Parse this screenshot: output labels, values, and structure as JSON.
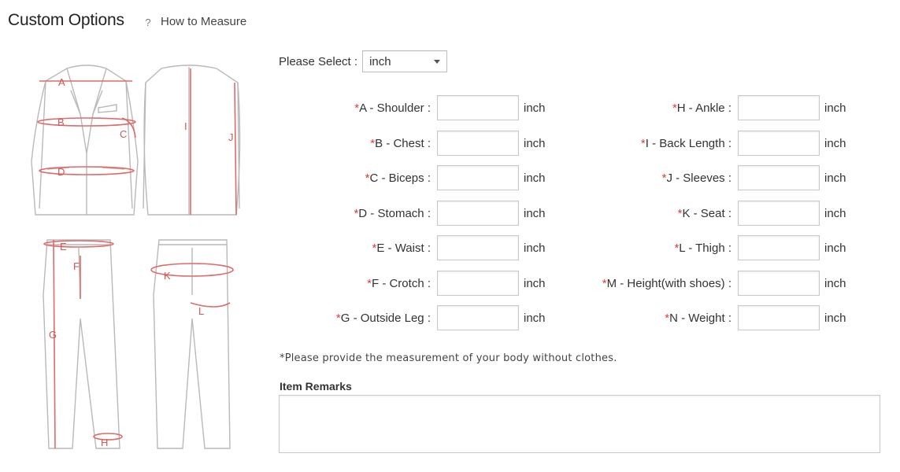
{
  "header": {
    "title": "Custom Options",
    "how_to_icon": "question-icon",
    "how_to_label": "How to Measure",
    "how_to_glyph": "?",
    "close_glyph": "^"
  },
  "unit_select": {
    "label": "Please Select :",
    "value": "inch"
  },
  "diagram_letters": [
    "A",
    "B",
    "C",
    "D",
    "E",
    "F",
    "G",
    "H",
    "I",
    "J",
    "K",
    "L"
  ],
  "fields_left": [
    {
      "label": "A - Shoulder :",
      "unit": "inch",
      "value": ""
    },
    {
      "label": "B - Chest :",
      "unit": "inch",
      "value": ""
    },
    {
      "label": "C - Biceps :",
      "unit": "inch",
      "value": ""
    },
    {
      "label": "D - Stomach :",
      "unit": "inch",
      "value": ""
    },
    {
      "label": "E - Waist :",
      "unit": "inch",
      "value": ""
    },
    {
      "label": "F - Crotch :",
      "unit": "inch",
      "value": ""
    },
    {
      "label": "G - Outside Leg :",
      "unit": "inch",
      "value": ""
    }
  ],
  "fields_right": [
    {
      "label": "H - Ankle :",
      "unit": "inch",
      "value": ""
    },
    {
      "label": "I - Back Length :",
      "unit": "inch",
      "value": ""
    },
    {
      "label": "J - Sleeves :",
      "unit": "inch",
      "value": ""
    },
    {
      "label": "K - Seat :",
      "unit": "inch",
      "value": ""
    },
    {
      "label": "L - Thigh :",
      "unit": "inch",
      "value": ""
    },
    {
      "label": "M - Height(with shoes) :",
      "unit": "inch",
      "value": ""
    },
    {
      "label": "N - Weight :",
      "unit": "inch",
      "value": ""
    }
  ],
  "required_mark": "*",
  "note": "*Please provide the measurement of your body without clothes.",
  "remarks": {
    "label": "Item Remarks",
    "value": ""
  },
  "colors": {
    "accent": "#e03a3a",
    "sketch": "#b9b9b9",
    "measure": "#e06a6a"
  }
}
